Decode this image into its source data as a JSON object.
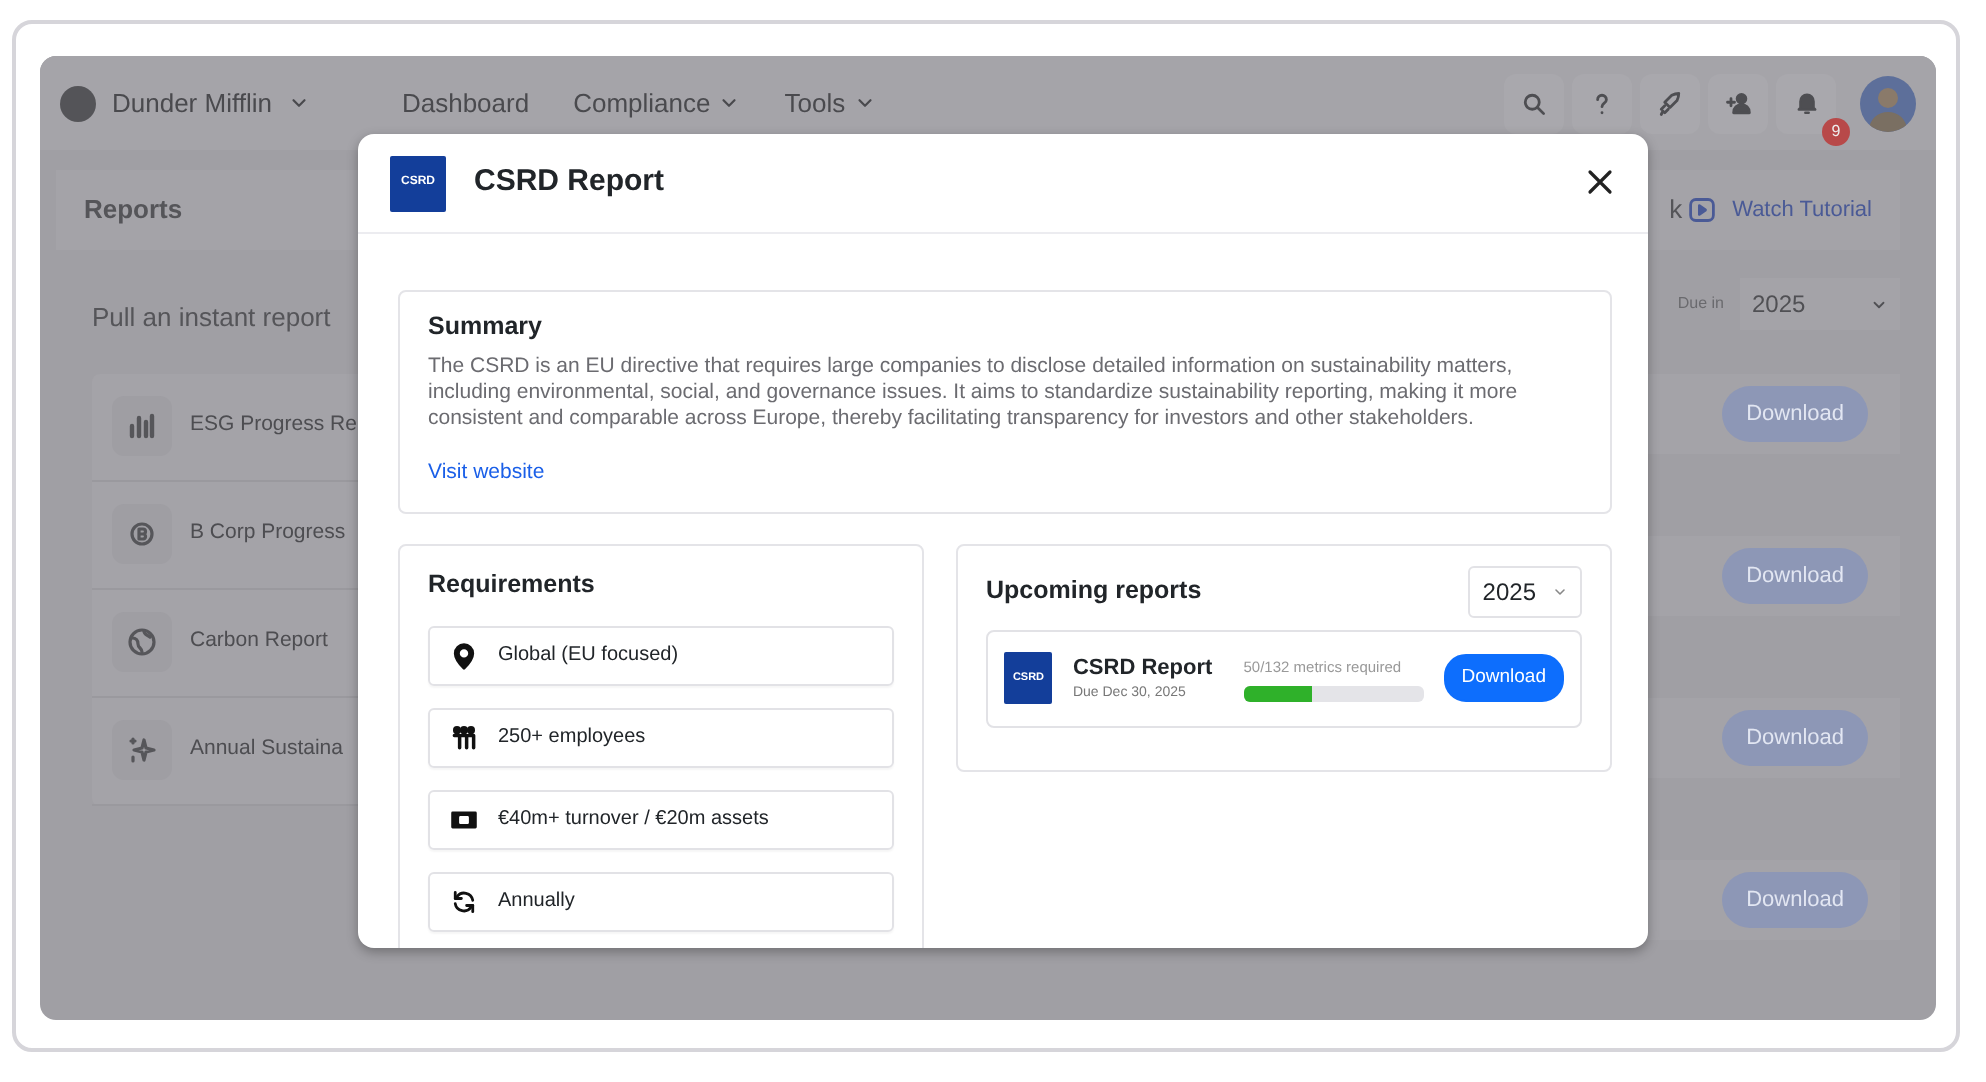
{
  "app": {
    "brand": "Dunder Mifflin",
    "nav": [
      {
        "label": "Dashboard",
        "dropdown": false
      },
      {
        "label": "Compliance",
        "dropdown": true
      },
      {
        "label": "Tools",
        "dropdown": true
      }
    ],
    "notification_count": "9"
  },
  "page": {
    "title": "Reports",
    "link_partial": "k",
    "tutorial": "Watch Tutorial",
    "section_title": "Pull an instant report",
    "due_label": "Due in",
    "due_year": "2025",
    "reports": [
      {
        "name": "ESG Progress Re",
        "kind": "chart"
      },
      {
        "name": "B Corp Progress",
        "kind": "bcorp"
      },
      {
        "name": "Carbon Report",
        "kind": "globe"
      },
      {
        "name": "Annual Sustaina",
        "kind": "sparkle"
      }
    ],
    "download_buttons": [
      "Download",
      "Download",
      "Download",
      "Download"
    ]
  },
  "modal": {
    "title": "CSRD Report",
    "logo": "CSRD",
    "summary": {
      "title": "Summary",
      "text": "The CSRD is an EU directive that requires large companies to disclose detailed information on sustainability matters, including environmental, social, and governance issues. It aims to standardize sustainability reporting, making it more consistent and comparable across Europe, thereby facilitating transparency for investors and other stakeholders.",
      "link": "Visit website"
    },
    "requirements": {
      "title": "Requirements",
      "items": [
        {
          "label": "Global (EU focused)",
          "kind": "location"
        },
        {
          "label": "250+ employees",
          "kind": "people"
        },
        {
          "label": "€40m+ turnover / €20m assets",
          "kind": "money"
        },
        {
          "label": "Annually",
          "kind": "cycle"
        }
      ]
    },
    "upcoming": {
      "title": "Upcoming reports",
      "year": "2025",
      "reports": [
        {
          "logo": "CSRD",
          "name": "CSRD Report",
          "due": "Due Dec 30, 2025",
          "metrics": "50/132 metrics required",
          "level": 0.38,
          "button": "Download"
        }
      ]
    }
  }
}
